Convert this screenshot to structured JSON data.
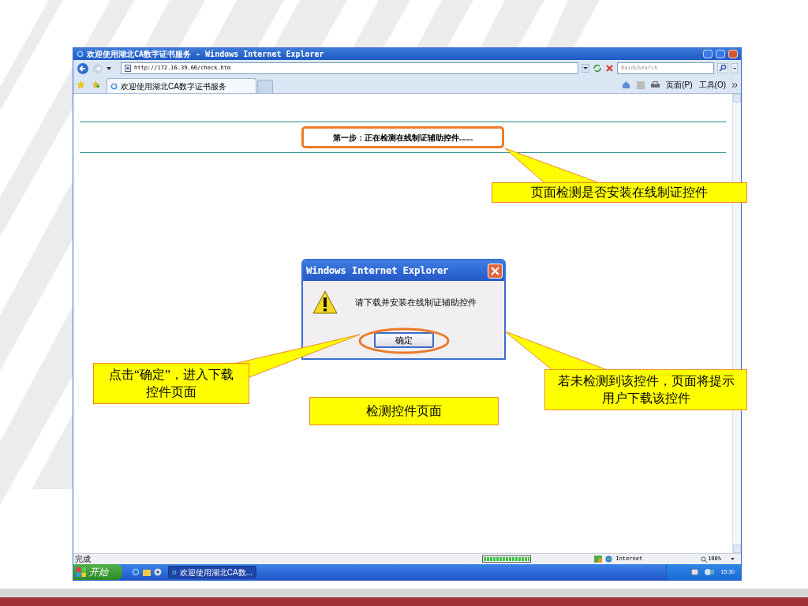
{
  "window": {
    "title": "欢迎使用湖北CA数字证书服务 - Windows Internet Explorer"
  },
  "address_bar": {
    "url": "http://172.16.39.60/check.htm"
  },
  "search_field": {
    "placeholder": "BaiduSearch"
  },
  "tabs": [
    {
      "label": "欢迎使用湖北CA数字证书服务",
      "selected": true
    }
  ],
  "command_bar": [
    {
      "label": "页面(P)"
    },
    {
      "label": "工具(O)"
    }
  ],
  "page": {
    "step_label": "第一步：正在检测在线制证辅助控件......."
  },
  "dialog": {
    "title": "Windows Internet Explorer",
    "message": "请下载并安装在线制证辅助控件",
    "button": "确定"
  },
  "status_bar": {
    "text": "完成",
    "progress": {
      "level": 1
    },
    "zone": "Internet",
    "zoom": "100%"
  },
  "taskbar": {
    "start": "开始",
    "items": [
      {
        "label": "欢迎使用湖北CA数...",
        "selected": true
      }
    ],
    "clock": "15:30"
  },
  "callouts": [
    {
      "text": "页面检测是否安装在线制证控件"
    },
    {
      "text": "点击“确定”，进入下载控件页面"
    },
    {
      "text": "检测控件页面"
    },
    {
      "text": "若未检测到该控件，页面将提示用户下载该控件"
    }
  ]
}
